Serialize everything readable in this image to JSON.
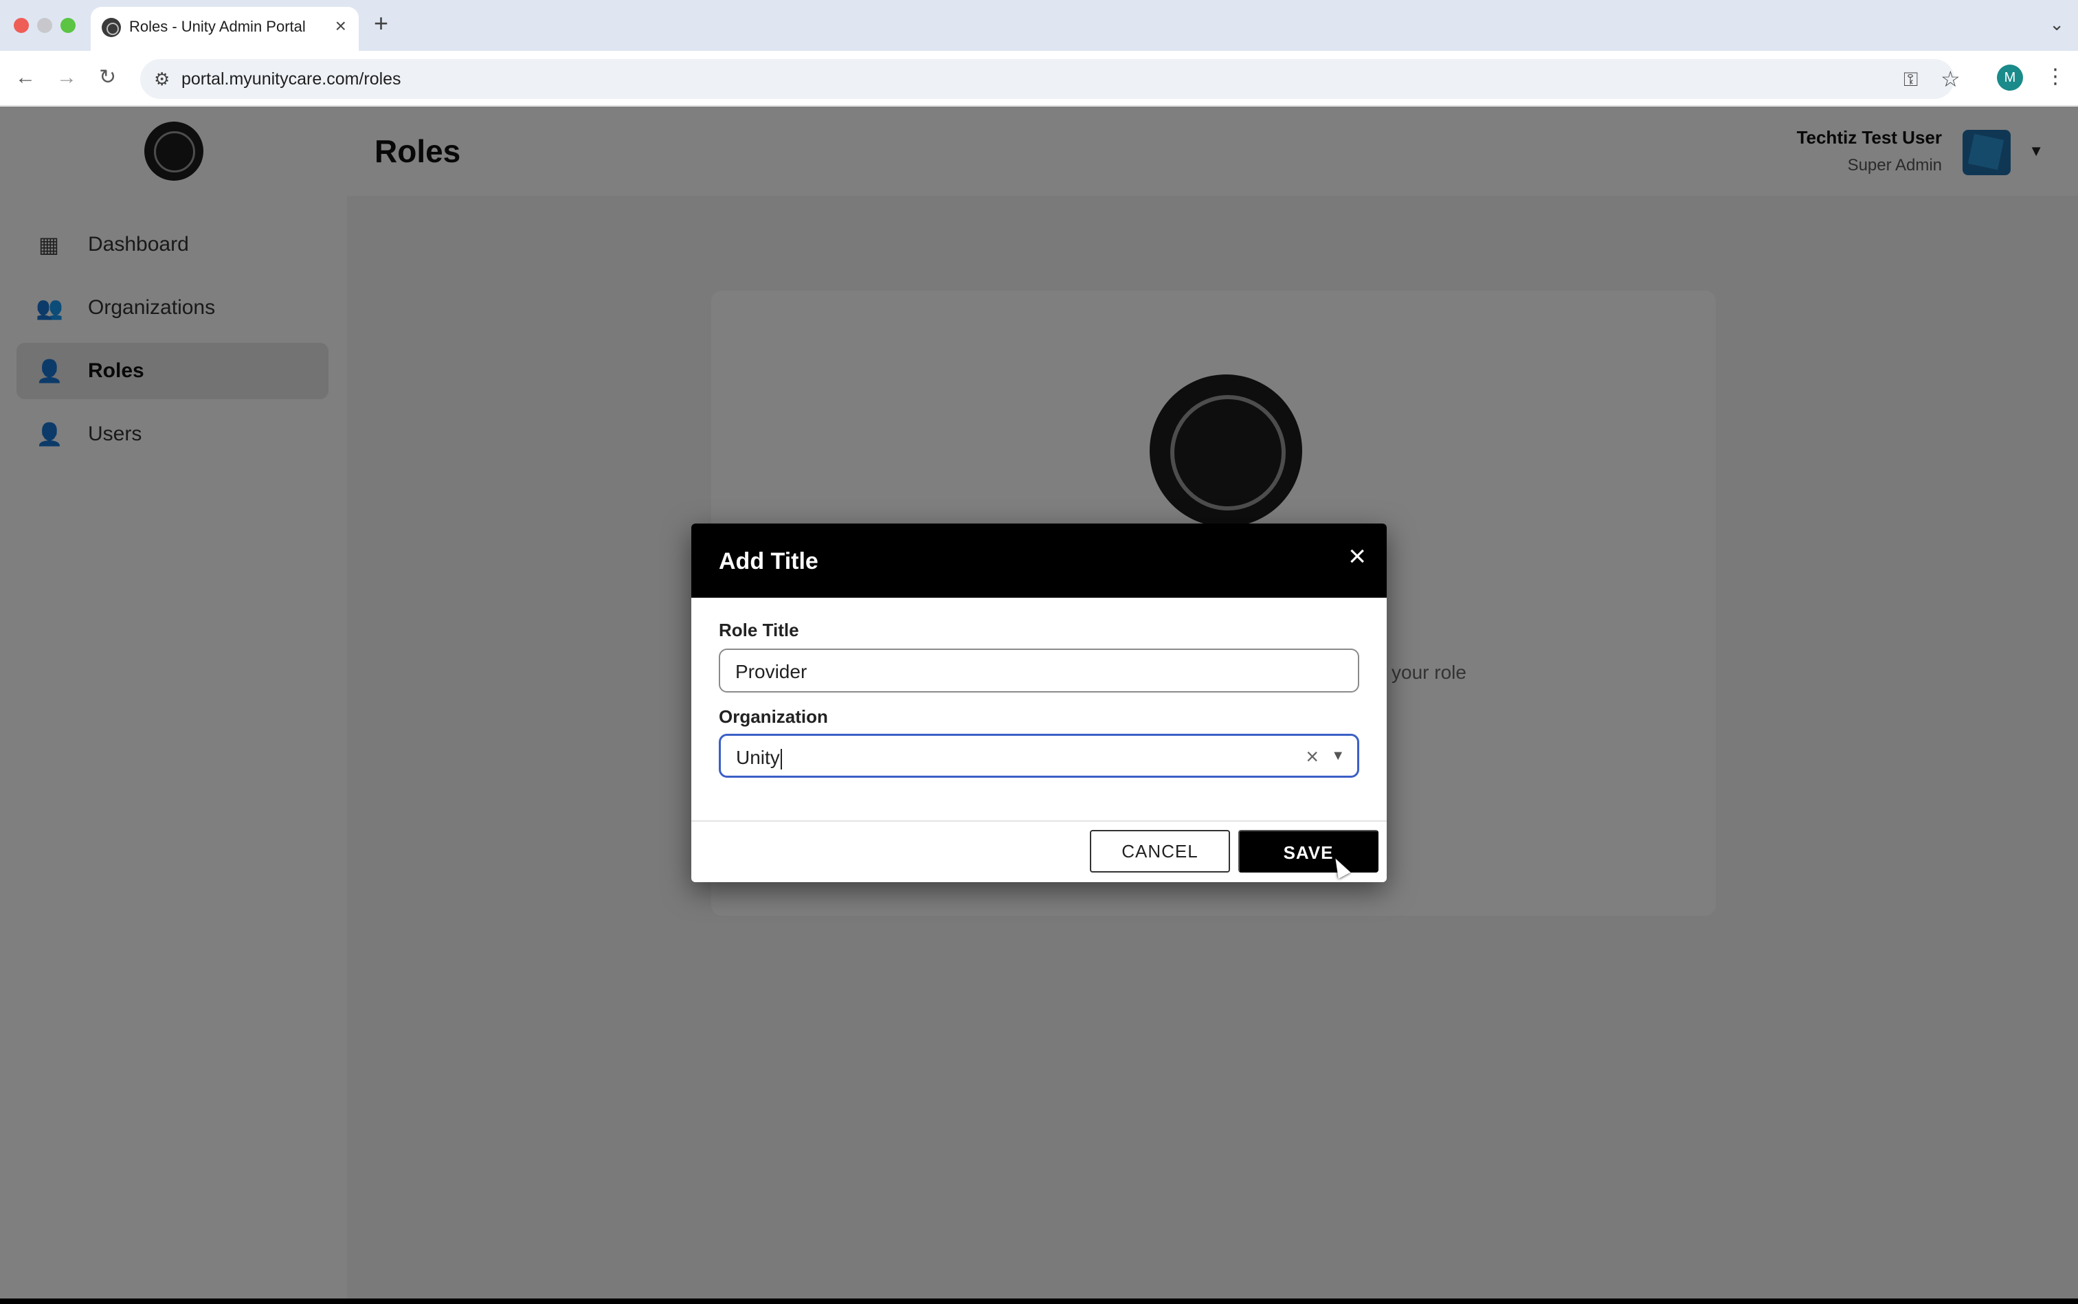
{
  "browser": {
    "tab_title": "Roles - Unity Admin Portal",
    "url": "portal.myunitycare.com/roles",
    "profile_initial": "M"
  },
  "sidebar": {
    "items": [
      {
        "label": "Dashboard",
        "active": false
      },
      {
        "label": "Organizations",
        "active": false
      },
      {
        "label": "Roles",
        "active": true
      },
      {
        "label": "Users",
        "active": false
      }
    ]
  },
  "header": {
    "title": "Roles",
    "user_name": "Techtiz Test User",
    "user_role": "Super Admin"
  },
  "content": {
    "partial_text": "your role"
  },
  "dialog": {
    "title": "Add Title",
    "role_title_label": "Role Title",
    "role_title_value": "Provider",
    "organization_label": "Organization",
    "organization_value": "Unity",
    "cancel_label": "CANCEL",
    "save_label": "SAVE"
  },
  "colors": {
    "dialog_header": "#000000",
    "focus_border": "#3b5fc6",
    "primary_button": "#000000"
  }
}
